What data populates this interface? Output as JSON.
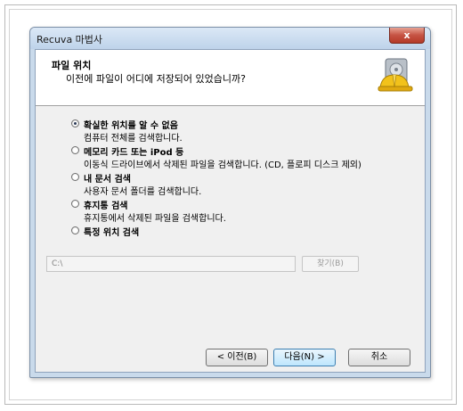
{
  "window": {
    "title": "Recuva 마법사",
    "close_label": "x"
  },
  "header": {
    "title": "파일 위치",
    "subtitle": "이전에 파일이 어디에 저장되어 있었습니까?",
    "icon": "recuva-hardhat-icon"
  },
  "options": [
    {
      "label": "확실한 위치를 알 수 없음",
      "description": "컴퓨터 전체를 검색합니다.",
      "selected": true
    },
    {
      "label": "메모리 카드 또는 iPod 등",
      "description": "이동식 드라이브에서 삭제된 파일을 검색합니다. (CD, 플로피 디스크 제외)",
      "selected": false
    },
    {
      "label": "내 문서 검색",
      "description": "사용자 문서 폴더를 검색합니다.",
      "selected": false
    },
    {
      "label": "휴지통 검색",
      "description": "휴지통에서 삭제된 파일을 검색합니다.",
      "selected": false
    },
    {
      "label": "특정 위치 검색",
      "description": "",
      "selected": false
    }
  ],
  "path": {
    "value": "C:\\",
    "browse_label": "찾기(B)"
  },
  "buttons": {
    "back": "< 이전(B)",
    "next": "다음(N) >",
    "cancel": "취소"
  }
}
